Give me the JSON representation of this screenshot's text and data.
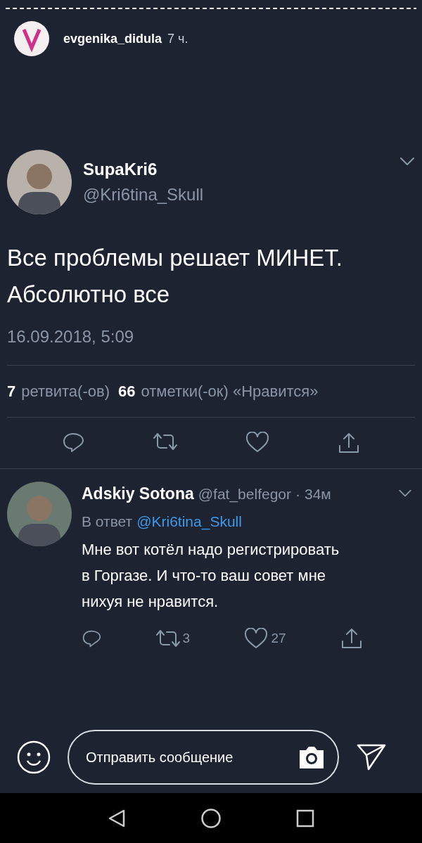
{
  "story": {
    "username": "evgenika_didula",
    "time": "7 ч.",
    "progress": {
      "level": 1
    }
  },
  "tweet": {
    "name": "SupaKri6",
    "handle": "@Kri6tina_Skull",
    "lines": [
      "Все проблемы решает МИНЕТ.",
      "Абсолютно все"
    ],
    "date": "16.09.2018, 5:09",
    "stats": [
      {
        "count": "7",
        "label": "ретвита(-ов)"
      },
      {
        "count": "66",
        "label": "отметки(-ок) «Нравится»"
      }
    ]
  },
  "reply": {
    "name": "Adskiy Sotona",
    "handle": "@fat_belfegor",
    "separator": "·",
    "time": "34м",
    "reply_prefix": "В ответ",
    "reply_to": "@Kri6tina_Skull",
    "lines": [
      "Мне вот котёл надо регистрировать",
      "в Горгазе. И что-то ваш совет мне",
      "нихуя не нравится."
    ],
    "retweets": "3",
    "likes": "27"
  },
  "message_bar": {
    "placeholder": "Отправить сообщение"
  }
}
